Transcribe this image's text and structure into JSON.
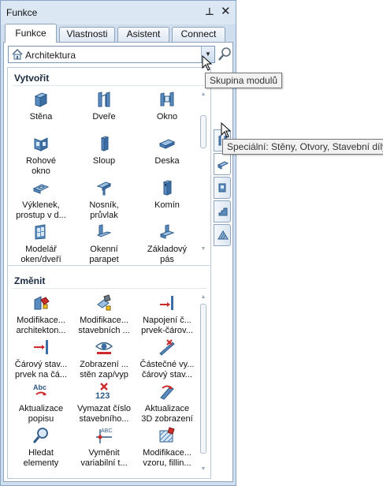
{
  "window": {
    "title": "Funkce",
    "pin_glyph": "ꟹ",
    "close_glyph": "✕"
  },
  "tabs": [
    {
      "label": "Funkce",
      "active": true
    },
    {
      "label": "Vlastnosti",
      "active": false
    },
    {
      "label": "Asistent",
      "active": false
    },
    {
      "label": "Connect",
      "active": false
    }
  ],
  "module_selector": {
    "value": "Architektura",
    "icon": "house-icon",
    "arrow_glyph": "▼"
  },
  "sections": {
    "create": {
      "title": "Vytvořit",
      "tools": [
        {
          "label": "Stěna",
          "icon": "wall-icon"
        },
        {
          "label": "Dveře",
          "icon": "door-icon"
        },
        {
          "label": "Okno",
          "icon": "window-icon"
        },
        {
          "label": "Rohové\nokno",
          "icon": "corner-window-icon"
        },
        {
          "label": "Sloup",
          "icon": "column-icon"
        },
        {
          "label": "Deska",
          "icon": "slab-icon"
        },
        {
          "label": "Výklenek,\nprostup v d...",
          "icon": "niche-icon"
        },
        {
          "label": "Nosník,\nprůvlak",
          "icon": "beam-icon"
        },
        {
          "label": "Komín",
          "icon": "chimney-icon"
        },
        {
          "label": "Modelář\noken/dveří",
          "icon": "window-modeler-icon"
        },
        {
          "label": "Okenní\nparapet",
          "icon": "window-sill-icon"
        },
        {
          "label": "Základový\npás",
          "icon": "strip-footing-icon"
        }
      ]
    },
    "modify": {
      "title": "Změnit",
      "tools": [
        {
          "label": "Modifikace...\narchitekton...",
          "icon": "modify-architecture-icon"
        },
        {
          "label": "Modifikace...\nstavebních ...",
          "icon": "modify-building-icon"
        },
        {
          "label": "Napojení č...\nprvek-čárov...",
          "icon": "connect-line-icon"
        },
        {
          "label": "Čárový stav...\nprvek na čá...",
          "icon": "line-element-icon"
        },
        {
          "label": "Zobrazení ...\nstěn zap/vyp",
          "icon": "eye-icon"
        },
        {
          "label": "Částečné vy...\nčárový stav...",
          "icon": "partial-delete-icon"
        },
        {
          "label": "Aktualizace\npopisu",
          "icon": "update-label-icon"
        },
        {
          "label": "Vymazat číslo\nstavebního...",
          "icon": "delete-number-icon"
        },
        {
          "label": "Aktualizace\n3D zobrazení",
          "icon": "update-3d-icon"
        },
        {
          "label": "Hledat\nelementy",
          "icon": "find-elements-icon"
        },
        {
          "label": "Vyměnit\nvariabilní t...",
          "icon": "replace-variable-icon"
        },
        {
          "label": "Modifikace...\nvzoru, fillin...",
          "icon": "modify-pattern-icon"
        }
      ]
    }
  },
  "side_tabs": [
    {
      "icon": "door-frame-icon",
      "active": false
    },
    {
      "icon": "special-element-icon",
      "active": true
    },
    {
      "icon": "walls-openings-icon",
      "active": false
    },
    {
      "icon": "stairs-icon",
      "active": false
    },
    {
      "icon": "roof-icon",
      "active": false
    }
  ],
  "tooltips": {
    "module_group": "Skupina modulů",
    "special": "Speciální: Stěny, Otvory, Stavební díly"
  },
  "colors": {
    "panel_bg": "#cfdff0",
    "tab_border": "#8fa4bb",
    "icon_blue": "#3a6ea5",
    "accent_red": "#cc2b2b",
    "accent_yellow": "#f0c020"
  }
}
